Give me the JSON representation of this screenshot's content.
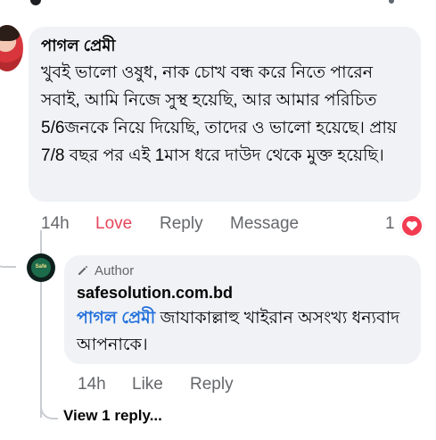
{
  "comment": {
    "author": "পাগল প্রেমী",
    "text": "খুবই  ভালো ওষুধ, নাক চোখ বন্ধ করে নিতে পারেন সবাই, আমি নিজে সুস্থ হয়েছি, আর আমার পরিচিত 5/6জনকে নিয়ে দিয়েছি, তাদের ও ভালো হয়েছে। প্রায় 7/8 বছর পর এই 1মাস ধরে দাউদ থেকে মুক্ত হয়েছি।",
    "time": "14h",
    "love_label": "Love",
    "reply_label": "Reply",
    "message_label": "Message",
    "reaction_count": "1",
    "reaction_icon": "heart-icon",
    "reaction_color": "#f23c52"
  },
  "reply": {
    "badge": "Author",
    "author": "safesolution.com.bd",
    "mention": "পাগল প্রেমী",
    "text": " জাযাকাল্লাহু খাইরান অসংখ্য ধন্যবাদ আপনাকে।",
    "time": "14h",
    "like_label": "Like",
    "reply_label": "Reply",
    "avatar_text": "Safe"
  },
  "view_replies": "View 1 reply...",
  "colors": {
    "mention": "#216fdb",
    "love": "#e4475a",
    "secondary_text": "#65676b",
    "bubble": "#f0f2f5"
  }
}
